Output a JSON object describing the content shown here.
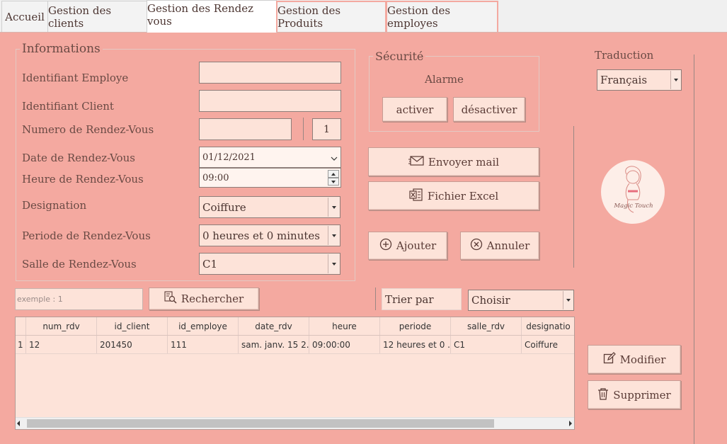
{
  "tabs": [
    {
      "label": "Accueil"
    },
    {
      "label": "Gestion des clients"
    },
    {
      "label": "Gestion des Rendez vous"
    },
    {
      "label": "Gestion des Produits"
    },
    {
      "label": "Gestion des employes"
    }
  ],
  "informations": {
    "legend": "Informations",
    "identifiant_employe_label": "Identifiant Employe",
    "identifiant_employe_value": "",
    "identifiant_client_label": "Identifiant Client",
    "identifiant_client_value": "",
    "numero_rdv_label": "Numero de Rendez-Vous",
    "numero_rdv_value": "",
    "numero_rdv_counter": "1",
    "date_label": "Date de Rendez-Vous",
    "date_value": "01/12/2021",
    "heure_label": "Heure de Rendez-Vous",
    "heure_value": "09:00",
    "designation_label": "Designation",
    "designation_value": "Coiffure",
    "periode_label": "Periode de Rendez-Vous",
    "periode_value": "0 heures et 0 minutes",
    "salle_label": "Salle de Rendez-Vous",
    "salle_value": "C1"
  },
  "securite": {
    "legend": "Sécurité",
    "alarme_label": "Alarme",
    "activer_label": "activer",
    "desactiver_label": "désactiver"
  },
  "actions": {
    "envoyer_mail": "Envoyer mail",
    "fichier_excel": "Fichier Excel",
    "ajouter": "Ajouter",
    "annuler": "Annuler",
    "modifier": "Modifier",
    "supprimer": "Supprimer"
  },
  "traduction": {
    "label": "Traduction",
    "value": "Français"
  },
  "logo": {
    "text": "Magic Touch"
  },
  "search": {
    "placeholder": "exemple : 1",
    "button_label": "Rechercher",
    "trier_label": "Trier par",
    "sort_value": "Choisir"
  },
  "table": {
    "columns": [
      "num_rdv",
      "id_client",
      "id_employe",
      "date_rdv",
      "heure",
      "periode",
      "salle_rdv",
      "designatio"
    ],
    "rows": [
      {
        "index": "1",
        "cells": [
          "12",
          "201450",
          "111",
          "sam. janv. 15 2...",
          "09:00:00",
          "12 heures et 0 ...",
          "C1",
          "Coiffure"
        ]
      }
    ]
  },
  "colors": {
    "background": "#f4a9a0",
    "field": "#fde3d9"
  }
}
